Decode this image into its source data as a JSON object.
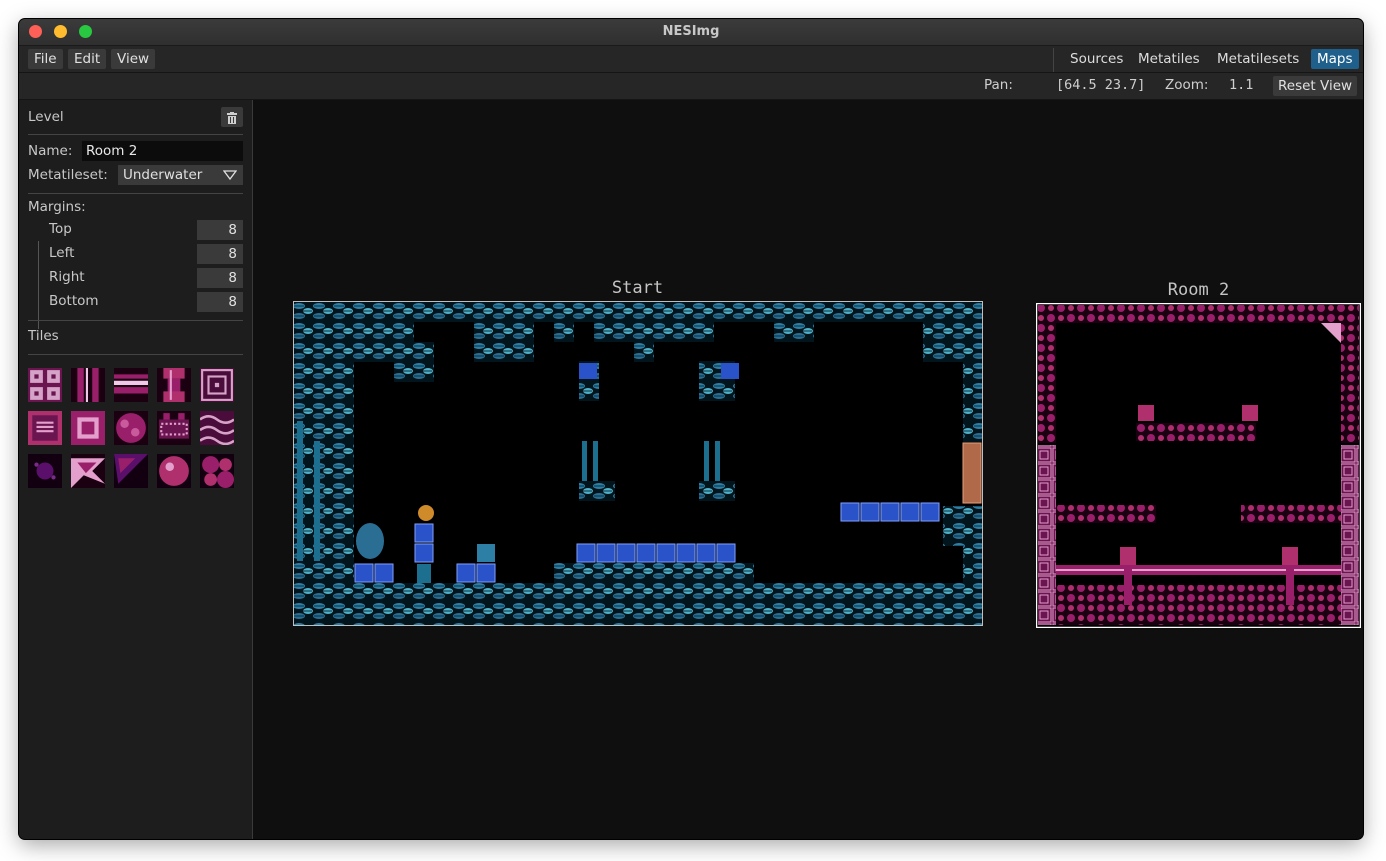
{
  "window": {
    "title": "NESImg"
  },
  "menu": {
    "file": "File",
    "edit": "Edit",
    "view": "View"
  },
  "nav": {
    "sources": "Sources",
    "metatiles": "Metatiles",
    "metatilesets": "Metatilesets",
    "maps": "Maps",
    "active": "Maps"
  },
  "toolbar": {
    "pan_label": "Pan:",
    "pan_value": "[64.5 23.7]",
    "zoom_label": "Zoom:",
    "zoom_value": "1.1",
    "reset_label": "Reset View"
  },
  "sidebar": {
    "section_level": "Level",
    "name_label": "Name:",
    "name_value": "Room 2",
    "metatileset_label": "Metatileset:",
    "metatileset_value": "Underwater",
    "margins_label": "Margins:",
    "margins": [
      {
        "label": "Top",
        "value": "8"
      },
      {
        "label": "Left",
        "value": "8"
      },
      {
        "label": "Right",
        "value": "8"
      },
      {
        "label": "Bottom",
        "value": "8"
      }
    ],
    "tiles_label": "Tiles",
    "tiles": [
      "grid-block",
      "vertical-bars",
      "horizontal-pipe",
      "column",
      "spiral-block",
      "panel-block",
      "framed-block",
      "round-rock",
      "spiked-block",
      "wavy-rock",
      "dark-coral",
      "pink-coral",
      "slope-rock",
      "bubble",
      "cluster-rock"
    ]
  },
  "maps": [
    {
      "title": "Start",
      "palette": "underwater-blue"
    },
    {
      "title": "Room 2",
      "palette": "magenta"
    }
  ],
  "colors": {
    "accent": "#1f5f8b",
    "blue_rock": "#2e7fa6",
    "blue_block": "#2a52c9",
    "magenta": "#9a1f6a",
    "pink": "#d97ab8",
    "orange": "#cf8a2a"
  }
}
